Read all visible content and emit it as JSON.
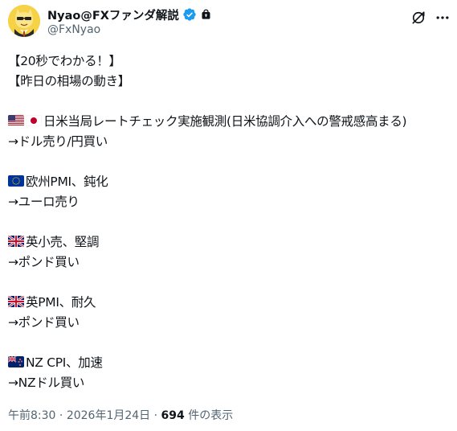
{
  "author": {
    "display_name": "Nyao@FXファンダ解説",
    "handle": "@FxNyao"
  },
  "tweet": {
    "lines": [
      {
        "text": "【20秒でわかる！】"
      },
      {
        "text": "【昨日の相場の動き】"
      },
      {
        "text": ""
      },
      {
        "flags": [
          "us",
          "jp"
        ],
        "text": "日米当局レートチェック実施観測(日米協調介入への警戒感高まる)"
      },
      {
        "text": "→ドル売り/円買い"
      },
      {
        "text": ""
      },
      {
        "flags": [
          "eu"
        ],
        "text": "欧州PMI、鈍化"
      },
      {
        "text": "→ユーロ売り"
      },
      {
        "text": ""
      },
      {
        "flags": [
          "gb"
        ],
        "text": "英小売、堅調"
      },
      {
        "text": "→ポンド買い"
      },
      {
        "text": ""
      },
      {
        "flags": [
          "gb"
        ],
        "text": "英PMI、耐久"
      },
      {
        "text": "→ポンド買い"
      },
      {
        "text": ""
      },
      {
        "flags": [
          "nz"
        ],
        "text": "NZ CPI、加速"
      },
      {
        "text": "→NZドル買い"
      }
    ]
  },
  "footer": {
    "time": "午前8:30",
    "separator": " · ",
    "date": "2026年1月24日",
    "views_count": "694",
    "views_label": " 件の表示"
  },
  "icons": {
    "verified": "verified-badge-icon",
    "lock": "lock-icon",
    "grok": "grok-icon",
    "more": "more-icon"
  },
  "colors": {
    "text": "#0f1419",
    "secondary_text": "#536471",
    "verified_blue": "#1d9bf0"
  }
}
